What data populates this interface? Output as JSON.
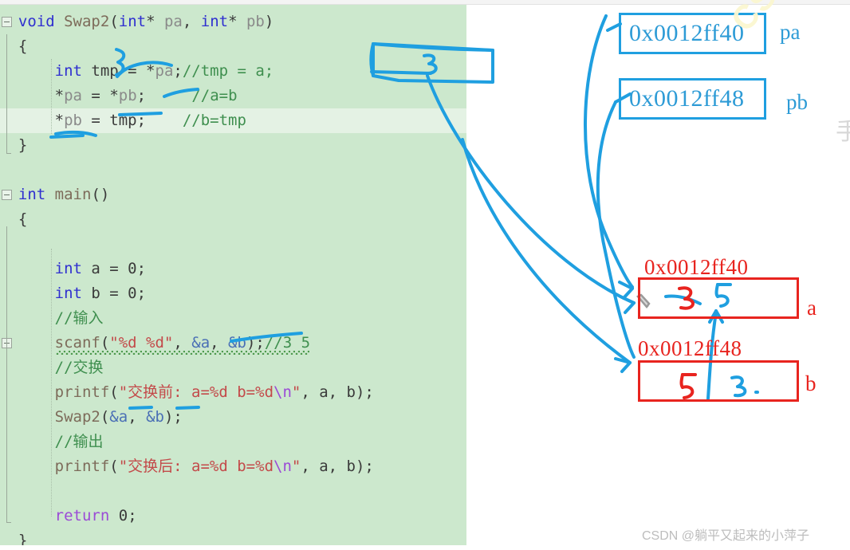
{
  "editor": {
    "language": "c",
    "lines": [
      {
        "id": "l1",
        "indent": 0,
        "fold": true,
        "tokens": [
          {
            "t": "void",
            "c": "kw"
          },
          {
            "t": " ",
            "c": "pln"
          },
          {
            "t": "Swap2",
            "c": "fn"
          },
          {
            "t": "(",
            "c": "pln"
          },
          {
            "t": "int",
            "c": "kw"
          },
          {
            "t": "* ",
            "c": "pln"
          },
          {
            "t": "pa",
            "c": "var"
          },
          {
            "t": ", ",
            "c": "pln"
          },
          {
            "t": "int",
            "c": "kw"
          },
          {
            "t": "* ",
            "c": "pln"
          },
          {
            "t": "pb",
            "c": "var"
          },
          {
            "t": ")",
            "c": "pln"
          }
        ]
      },
      {
        "id": "l2",
        "indent": 0,
        "tokens": [
          {
            "t": "{",
            "c": "pln"
          }
        ]
      },
      {
        "id": "l3",
        "indent": 1,
        "tokens": [
          {
            "t": "int",
            "c": "kw"
          },
          {
            "t": " tmp = ",
            "c": "pln"
          },
          {
            "t": "*",
            "c": "pln"
          },
          {
            "t": "pa",
            "c": "var"
          },
          {
            "t": ";",
            "c": "pln"
          },
          {
            "t": "//tmp = a;",
            "c": "cmt"
          }
        ]
      },
      {
        "id": "l4",
        "indent": 1,
        "tokens": [
          {
            "t": "*",
            "c": "pln"
          },
          {
            "t": "pa",
            "c": "var"
          },
          {
            "t": " = ",
            "c": "pln"
          },
          {
            "t": "*",
            "c": "pln"
          },
          {
            "t": "pb",
            "c": "var"
          },
          {
            "t": ";",
            "c": "pln"
          },
          {
            "t": "     ",
            "c": "pln"
          },
          {
            "t": "//a=b",
            "c": "cmt"
          }
        ]
      },
      {
        "id": "l5",
        "indent": 1,
        "hl": true,
        "tokens": [
          {
            "t": "*",
            "c": "pln"
          },
          {
            "t": "pb",
            "c": "var"
          },
          {
            "t": " = tmp;",
            "c": "pln"
          },
          {
            "t": "    ",
            "c": "pln"
          },
          {
            "t": "//b=tmp",
            "c": "cmt"
          }
        ]
      },
      {
        "id": "l6",
        "indent": 0,
        "tokens": [
          {
            "t": "}",
            "c": "pln"
          }
        ]
      },
      {
        "id": "l7",
        "indent": 0,
        "tokens": []
      },
      {
        "id": "l8",
        "indent": 0,
        "fold": true,
        "tokens": [
          {
            "t": "int",
            "c": "kw"
          },
          {
            "t": " ",
            "c": "pln"
          },
          {
            "t": "main",
            "c": "fn"
          },
          {
            "t": "()",
            "c": "pln"
          }
        ]
      },
      {
        "id": "l9",
        "indent": 0,
        "tokens": [
          {
            "t": "{",
            "c": "pln"
          }
        ]
      },
      {
        "id": "l10",
        "indent": 0,
        "tokens": []
      },
      {
        "id": "l11",
        "indent": 1,
        "tokens": [
          {
            "t": "int",
            "c": "kw"
          },
          {
            "t": " a = ",
            "c": "pln"
          },
          {
            "t": "0",
            "c": "num"
          },
          {
            "t": ";",
            "c": "pln"
          }
        ]
      },
      {
        "id": "l12",
        "indent": 1,
        "tokens": [
          {
            "t": "int",
            "c": "kw"
          },
          {
            "t": " b = ",
            "c": "pln"
          },
          {
            "t": "0",
            "c": "num"
          },
          {
            "t": ";",
            "c": "pln"
          }
        ]
      },
      {
        "id": "l13",
        "indent": 1,
        "tokens": [
          {
            "t": "//输入",
            "c": "cmt"
          }
        ]
      },
      {
        "id": "l14",
        "indent": 1,
        "fold": true,
        "squiggle": true,
        "tokens": [
          {
            "t": "scanf",
            "c": "fn"
          },
          {
            "t": "(",
            "c": "pln"
          },
          {
            "t": "\"%d %d\"",
            "c": "str"
          },
          {
            "t": ", ",
            "c": "pln"
          },
          {
            "t": "&a",
            "c": "amp"
          },
          {
            "t": ", ",
            "c": "pln"
          },
          {
            "t": "&b",
            "c": "amp"
          },
          {
            "t": ");",
            "c": "pln"
          },
          {
            "t": "//3 5",
            "c": "cmt"
          }
        ]
      },
      {
        "id": "l15",
        "indent": 1,
        "tokens": [
          {
            "t": "//交换",
            "c": "cmt"
          }
        ]
      },
      {
        "id": "l16",
        "indent": 1,
        "tokens": [
          {
            "t": "printf",
            "c": "fn"
          },
          {
            "t": "(",
            "c": "pln"
          },
          {
            "t": "\"交换前: a=%d b=%d",
            "c": "str"
          },
          {
            "t": "\\n",
            "c": "esc"
          },
          {
            "t": "\"",
            "c": "str"
          },
          {
            "t": ", a, b);",
            "c": "pln"
          }
        ]
      },
      {
        "id": "l17",
        "indent": 1,
        "tokens": [
          {
            "t": "Swap2",
            "c": "fn"
          },
          {
            "t": "(",
            "c": "pln"
          },
          {
            "t": "&a",
            "c": "amp"
          },
          {
            "t": ", ",
            "c": "pln"
          },
          {
            "t": "&b",
            "c": "amp"
          },
          {
            "t": ");",
            "c": "pln"
          }
        ]
      },
      {
        "id": "l18",
        "indent": 1,
        "tokens": [
          {
            "t": "//输出",
            "c": "cmt"
          }
        ]
      },
      {
        "id": "l19",
        "indent": 1,
        "tokens": [
          {
            "t": "printf",
            "c": "fn"
          },
          {
            "t": "(",
            "c": "pln"
          },
          {
            "t": "\"交换后: a=%d b=%d",
            "c": "str"
          },
          {
            "t": "\\n",
            "c": "esc"
          },
          {
            "t": "\"",
            "c": "str"
          },
          {
            "t": ", a, b);",
            "c": "pln"
          }
        ]
      },
      {
        "id": "l20",
        "indent": 1,
        "tokens": []
      },
      {
        "id": "l21",
        "indent": 1,
        "tokens": [
          {
            "t": "return",
            "c": "ret"
          },
          {
            "t": " ",
            "c": "pln"
          },
          {
            "t": "0",
            "c": "num"
          },
          {
            "t": ";",
            "c": "pln"
          }
        ]
      },
      {
        "id": "l22",
        "indent": 0,
        "tokens": [
          {
            "t": "}",
            "c": "pln"
          }
        ]
      }
    ]
  },
  "annotations": {
    "pointer_boxes": [
      {
        "id": "pa-box",
        "value": "0x0012ff40",
        "label": "pa"
      },
      {
        "id": "pb-box",
        "value": "0x0012ff48",
        "label": "pb"
      }
    ],
    "memory_cells": [
      {
        "id": "cell-a",
        "address": "0x0012ff40",
        "label": "a",
        "old_value": "3",
        "new_value": "5"
      },
      {
        "id": "cell-b",
        "address": "0x0012ff48",
        "label": "b",
        "old_value": "5",
        "new_value": "3"
      }
    ],
    "tmp_box": {
      "id": "tmp-box",
      "value": "3"
    },
    "colors": {
      "ink_blue": "#1f9fe0",
      "box_red": "#e8241f",
      "editor_background": "#cce8cd",
      "highlight_line": "#e4f2e4"
    }
  },
  "watermarks": {
    "diagonal": "CSDN@躺平又起来的小萍子",
    "bottom": "CSDN @躺平又起来的小萍子",
    "edge_char": "手"
  }
}
